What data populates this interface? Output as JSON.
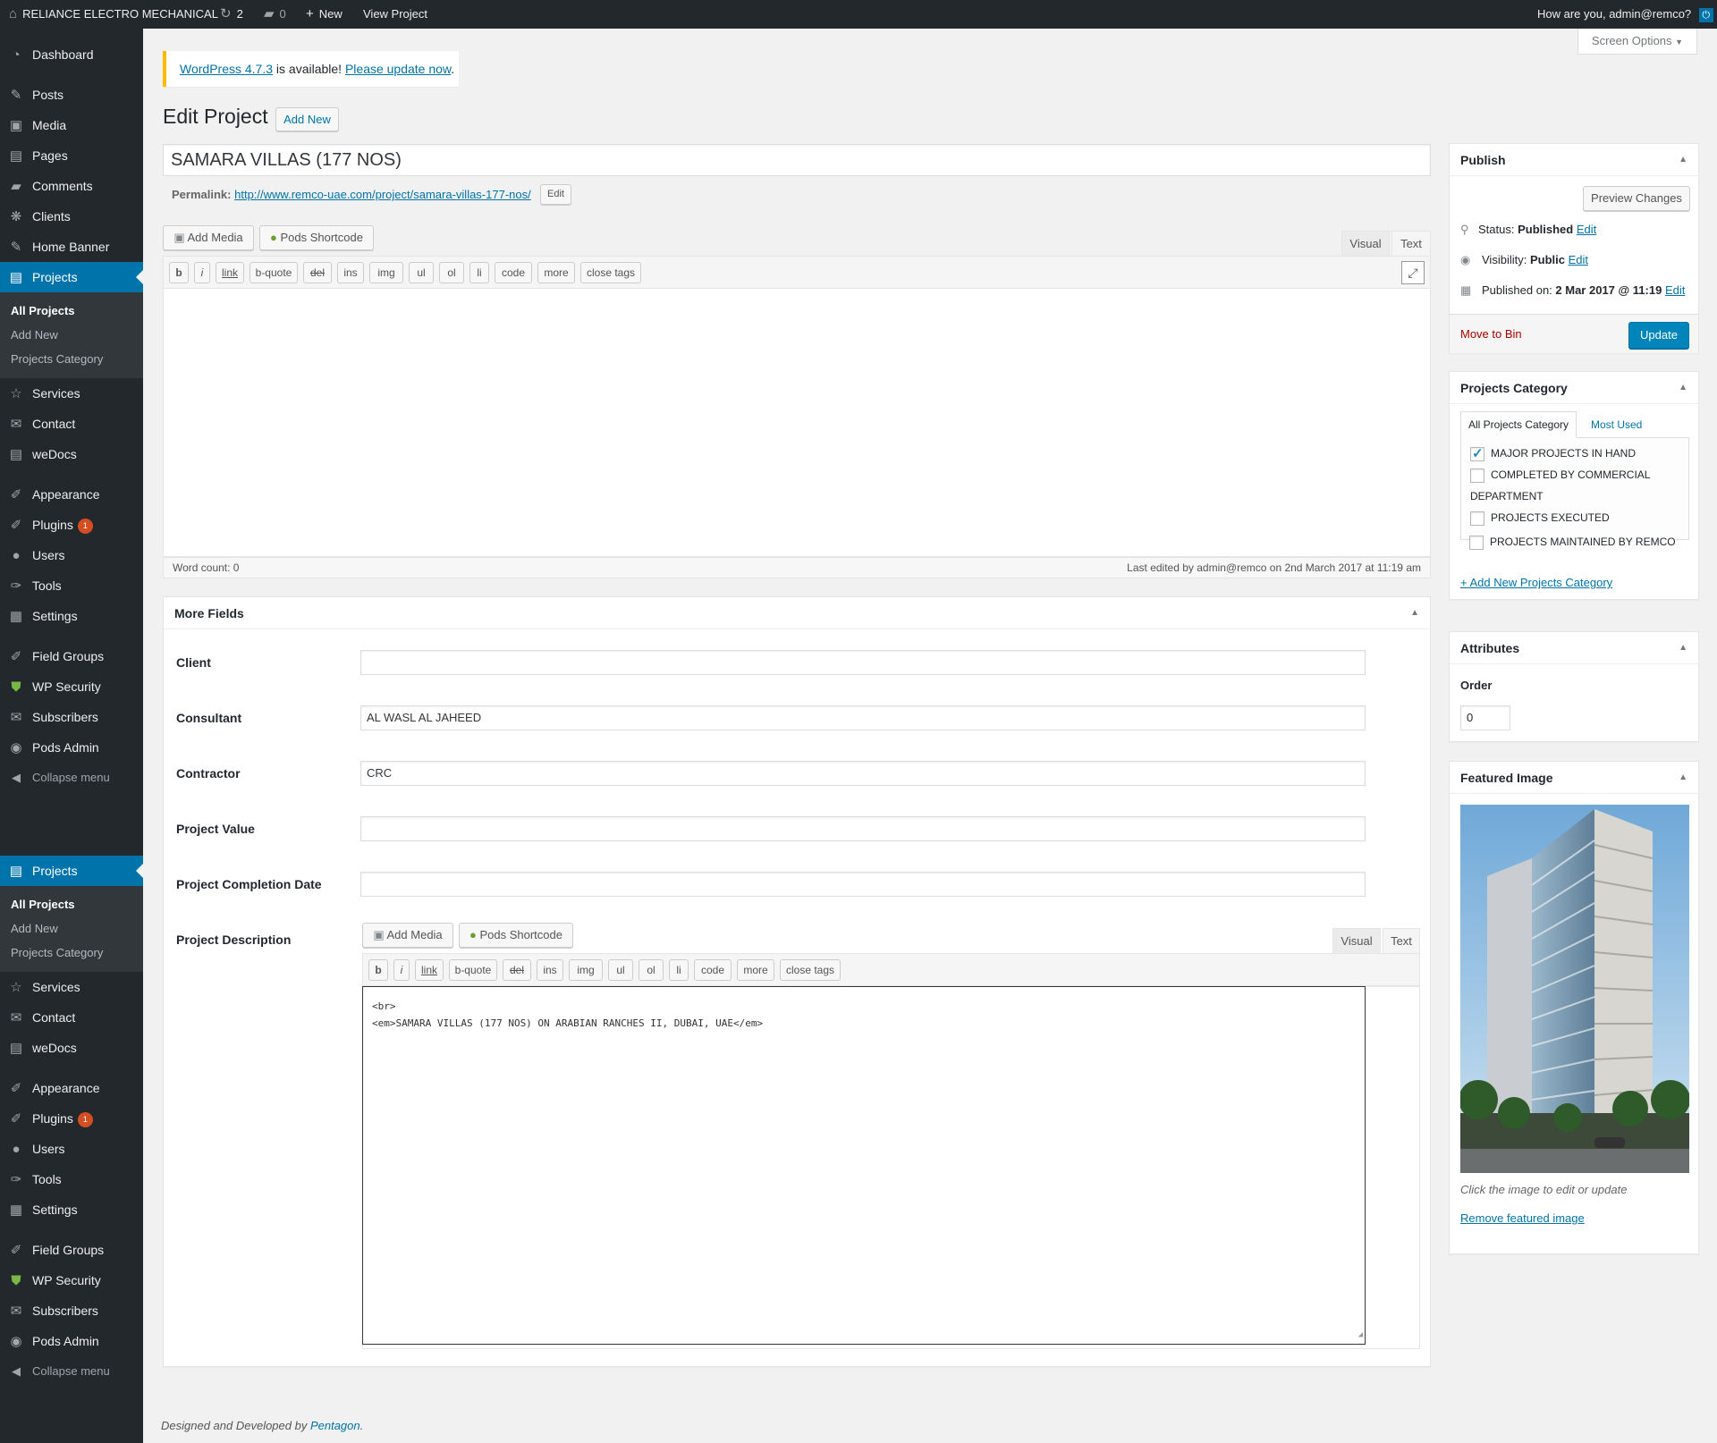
{
  "adminbar": {
    "site_name": "RELIANCE ELECTRO MECHANICAL",
    "updates_count": "2",
    "comments_count": "0",
    "new_label": "New",
    "view_label": "View Project",
    "greeting": "How are you, admin@remco?"
  },
  "sidebar": {
    "menu_top": [
      {
        "label": "Dashboard",
        "icon": "dashboard-icon"
      },
      {
        "label": "Posts",
        "icon": "pin-icon"
      },
      {
        "label": "Media",
        "icon": "media-icon"
      },
      {
        "label": "Pages",
        "icon": "pages-icon"
      },
      {
        "label": "Comments",
        "icon": "comments-icon"
      },
      {
        "label": "Clients",
        "icon": "clients-icon"
      },
      {
        "label": "Home Banner",
        "icon": "pin-icon"
      },
      {
        "label": "Projects",
        "icon": "projects-icon"
      }
    ],
    "submenu": [
      "All Projects",
      "Add New",
      "Projects Category"
    ],
    "menu_bottom": [
      {
        "label": "Services",
        "icon": "star-icon"
      },
      {
        "label": "Contact",
        "icon": "mail-icon"
      },
      {
        "label": "weDocs",
        "icon": "docs-icon"
      },
      {
        "label": "Appearance",
        "icon": "brush-icon"
      },
      {
        "label": "Plugins",
        "icon": "plugin-icon",
        "badge": "1"
      },
      {
        "label": "Users",
        "icon": "user-icon"
      },
      {
        "label": "Tools",
        "icon": "wrench-icon"
      },
      {
        "label": "Settings",
        "icon": "settings-icon"
      },
      {
        "label": "Field Groups",
        "icon": "brush-icon"
      },
      {
        "label": "WP Security",
        "icon": "shield-icon"
      },
      {
        "label": "Subscribers",
        "icon": "mail-icon"
      },
      {
        "label": "Pods Admin",
        "icon": "pods-icon"
      }
    ],
    "collapse": "Collapse menu"
  },
  "screen_options": "Screen Options",
  "notice": {
    "version_link": "WordPress 4.7.3",
    "middle": " is available! ",
    "update_link": "Please update now",
    "end": "."
  },
  "heading": {
    "title": "Edit Project",
    "add_new": "Add New"
  },
  "post": {
    "title": "SAMARA VILLAS (177 NOS)",
    "permalink_label": "Permalink:",
    "permalink_url": "http://www.remco-uae.com/project/samara-villas-177-nos/",
    "edit_btn": "Edit"
  },
  "editor": {
    "add_media": "Add Media",
    "pods_shortcode": "Pods Shortcode",
    "tab_visual": "Visual",
    "tab_text": "Text",
    "quicktags": [
      "b",
      "i",
      "link",
      "b-quote",
      "del",
      "ins",
      "img",
      "ul",
      "ol",
      "li",
      "code",
      "more",
      "close tags"
    ],
    "word_count": "Word count: 0",
    "last_edited": "Last edited by admin@remco on 2nd March 2017 at 11:19 am"
  },
  "more_fields": {
    "title": "More Fields",
    "client_label": "Client",
    "client_value": "",
    "consultant_label": "Consultant",
    "consultant_value": "AL WASL AL JAHEED",
    "contractor_label": "Contractor",
    "contractor_value": "CRC",
    "value_label": "Project Value",
    "value_value": "",
    "date_label": "Project Completion Date",
    "date_value": "",
    "desc_label": "Project Description",
    "desc_line1": "<br>",
    "desc_line2": "<em>SAMARA VILLAS (177 NOS) ON ARABIAN RANCHES II, DUBAI, UAE</em>"
  },
  "publish": {
    "title": "Publish",
    "preview": "Preview Changes",
    "status_label": "Status:",
    "status_value": "Published",
    "visibility_label": "Visibility:",
    "visibility_value": "Public",
    "published_label": "Published on:",
    "published_value": "2 Mar 2017 @ 11:19",
    "edit": "Edit",
    "move_to_bin": "Move to Bin",
    "update": "Update"
  },
  "categories": {
    "title": "Projects Category",
    "tab_all": "All Projects Category",
    "tab_most": "Most Used",
    "items": [
      {
        "label": "MAJOR PROJECTS IN HAND",
        "checked": true
      },
      {
        "label": "COMPLETED BY COMMERCIAL",
        "checked": false
      },
      {
        "label": "DEPARTMENT",
        "checked": false
      },
      {
        "label": "PROJECTS EXECUTED",
        "checked": false
      },
      {
        "label": "PROJECTS MAINTAINED BY REMCO",
        "checked": false
      }
    ],
    "add_new": "+ Add New Projects Category"
  },
  "attributes": {
    "title": "Attributes",
    "order_label": "Order",
    "order_value": "0"
  },
  "featured": {
    "title": "Featured Image",
    "hint": "Click the image to edit or update",
    "remove": "Remove featured image"
  },
  "footer": {
    "text": "Designed and Developed by ",
    "link": "Pentagon",
    "end": "."
  },
  "colors": {
    "accent": "#0073aa",
    "sidebar": "#23282d",
    "update_btn": "#0085ba",
    "badge": "#d54e21"
  }
}
